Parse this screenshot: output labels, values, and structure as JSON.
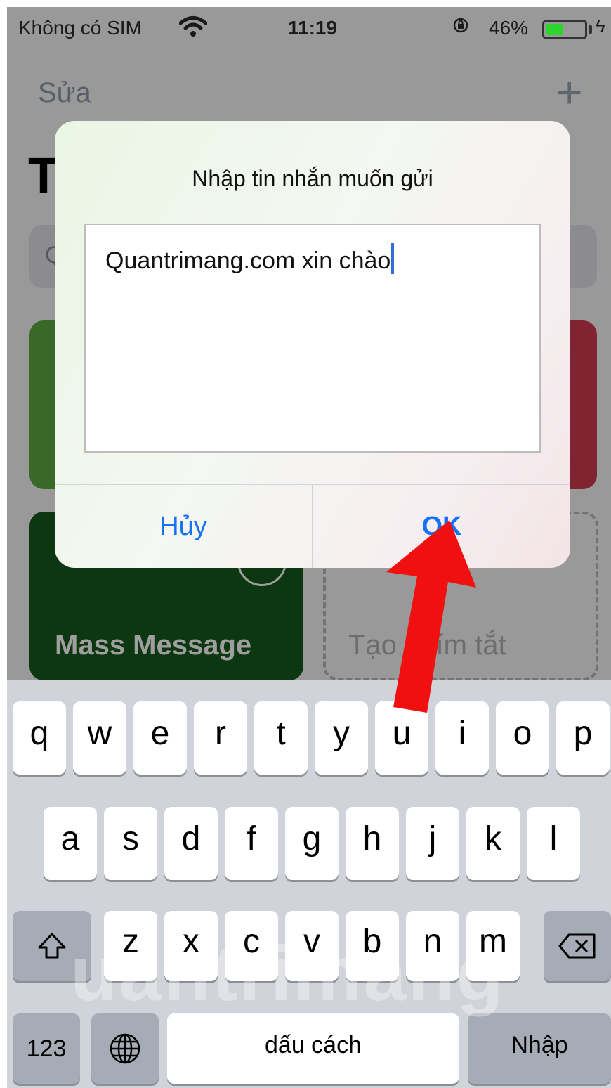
{
  "status_bar": {
    "carrier": "Không có SIM",
    "time": "11:19",
    "battery_percent_label": "46%",
    "battery_level": 0.46,
    "battery_color": "#2bd52b"
  },
  "background_app": {
    "edit_label": "Sửa",
    "add_icon": "plus-icon",
    "title_partial": "T",
    "search_icon": "search-icon",
    "shortcut_cards": [
      {
        "label": "",
        "color": "#5ea843"
      },
      {
        "label": "",
        "color": "#d13a4f"
      },
      {
        "label": "Mass Message",
        "color": "#16591a"
      },
      {
        "label": "Tạo phím tắt",
        "color": "#b8b8bc"
      }
    ]
  },
  "alert": {
    "title": "Nhập tin nhắn muốn gửi",
    "input_value": "Quantrimang.com xin chào",
    "cancel_label": "Hủy",
    "ok_label": "OK",
    "accent_color": "#1672f5"
  },
  "keyboard": {
    "row1": [
      "q",
      "w",
      "e",
      "r",
      "t",
      "y",
      "u",
      "i",
      "o",
      "p"
    ],
    "row2": [
      "a",
      "s",
      "d",
      "f",
      "g",
      "h",
      "j",
      "k",
      "l"
    ],
    "row3": [
      "z",
      "x",
      "c",
      "v",
      "b",
      "n",
      "m"
    ],
    "numbers_label": "123",
    "space_label": "dấu cách",
    "return_label": "Nhập",
    "shift_icon": "shift-icon",
    "delete_icon": "delete-icon",
    "globe_icon": "globe-icon"
  },
  "watermark": "uantrimang",
  "annotation": {
    "arrow_color": "#f01010",
    "arrow_icon": "arrow-up-icon"
  }
}
